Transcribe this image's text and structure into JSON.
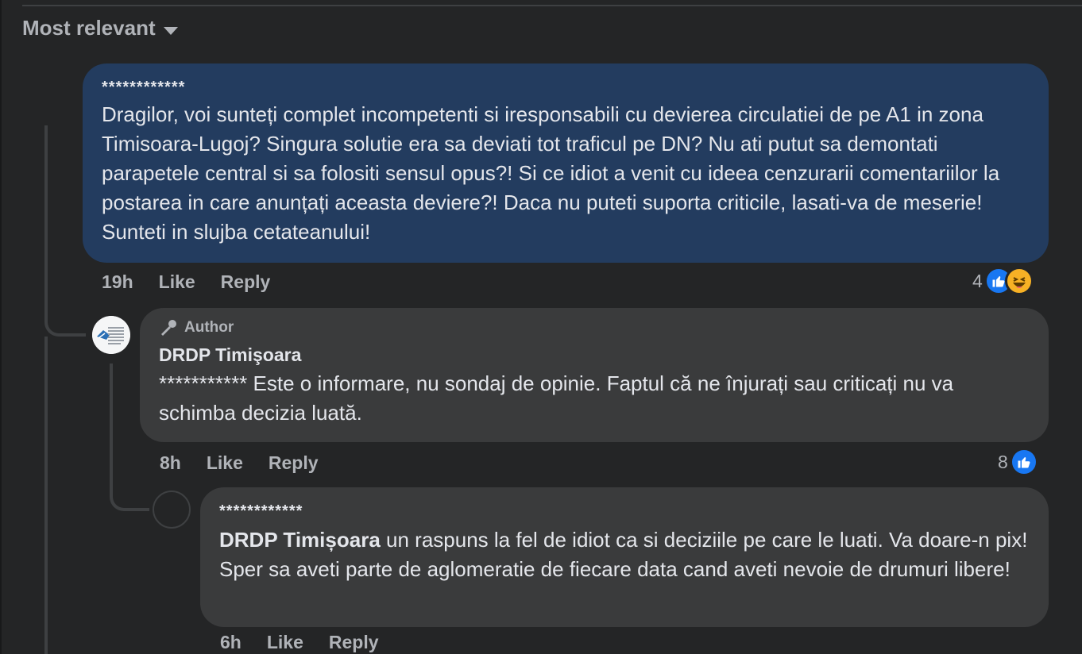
{
  "sort": {
    "label": "Most relevant"
  },
  "comments": [
    {
      "name": "************",
      "text": "Dragilor, voi sunteți complet incompetenti si iresponsabili cu devierea circulatiei de pe A1 in zona Timisoara-Lugoj? Singura solutie era sa deviati tot traficul pe DN? Nu ati putut sa demontati parapetele central si sa folositi sensul opus?! Si ce idiot a venit cu ideea cenzurarii comentariilor la postarea in care anunțați aceasta deviere?! Daca nu puteti suporta criticile, lasati-va de meserie! Sunteti in slujba cetateanului!",
      "time": "19h",
      "like_label": "Like",
      "reply_label": "Reply",
      "reaction_count": "4",
      "reactions": [
        "like-icon",
        "haha-icon"
      ]
    },
    {
      "badge": "Author",
      "name": "DRDP Timişoara",
      "mention": "***********",
      "text": " Este o informare, nu sondaj de opinie. Faptul că ne înjurați sau criticați nu va schimba decizia luată.",
      "time": "8h",
      "like_label": "Like",
      "reply_label": "Reply",
      "reaction_count": "8",
      "reactions": [
        "like-icon"
      ]
    },
    {
      "name": "************",
      "mention": "DRDP Timișoara",
      "text": " un raspuns la fel de idiot ca si deciziile pe care le luati. Va doare-n pix! Sper sa aveti parte de aglomeratie de fiecare data cand aveti nevoie de drumuri libere!",
      "time": "6h",
      "like_label": "Like",
      "reply_label": "Reply"
    }
  ],
  "colors": {
    "page_bg": "#242526",
    "main_bubble": "#233c5f",
    "reply_bubble": "#3a3b3c",
    "like_blue": "#1877f2",
    "haha_yellow": "#f7b125"
  }
}
